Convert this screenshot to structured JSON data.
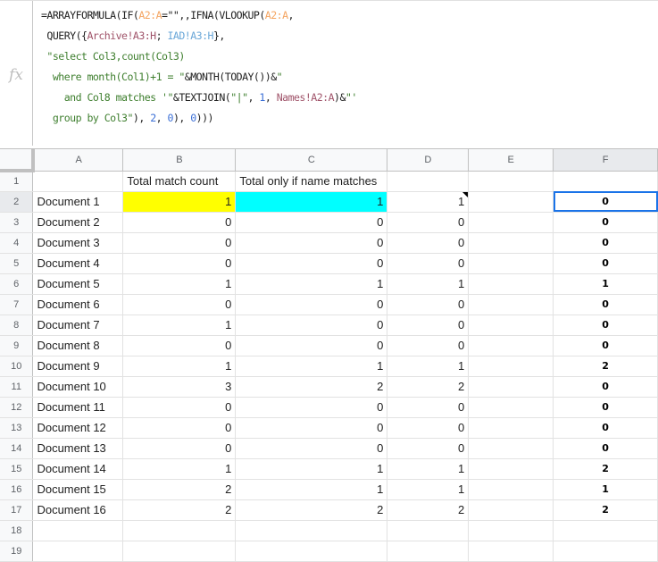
{
  "formula_bar": {
    "fx_label": "fx",
    "lines": [
      [
        {
          "t": "=ARRAYFORMULA(IF(",
          "c": ""
        },
        {
          "t": "A2:A",
          "c": "a"
        },
        {
          "t": "=\"\",,IFNA(VLOOKUP(",
          "c": ""
        },
        {
          "t": "A2:A",
          "c": "a"
        },
        {
          "t": ",",
          "c": ""
        }
      ],
      [
        {
          "t": " QUERY({",
          "c": ""
        },
        {
          "t": "Archive!A3:H",
          "c": "c"
        },
        {
          "t": "; ",
          "c": ""
        },
        {
          "t": "IAD!A3:H",
          "c": "b"
        },
        {
          "t": "},",
          "c": ""
        }
      ],
      [
        {
          "t": " \"select Col3,count(Col3)",
          "c": "s"
        }
      ],
      [
        {
          "t": "  where month(Col1)+1 = \"",
          "c": "s"
        },
        {
          "t": "&MONTH(TODAY())&",
          "c": ""
        },
        {
          "t": "\"",
          "c": "s"
        }
      ],
      [
        {
          "t": "    and Col8 matches '\"",
          "c": "s"
        },
        {
          "t": "&TEXTJOIN(",
          "c": ""
        },
        {
          "t": "\"|\"",
          "c": "s"
        },
        {
          "t": ", ",
          "c": ""
        },
        {
          "t": "1",
          "c": "n"
        },
        {
          "t": ", ",
          "c": ""
        },
        {
          "t": "Names!A2:A",
          "c": "c"
        },
        {
          "t": ")&",
          "c": ""
        },
        {
          "t": "\"'",
          "c": "s"
        }
      ],
      [
        {
          "t": "  group by Col3\"",
          "c": "s"
        },
        {
          "t": "), ",
          "c": ""
        },
        {
          "t": "2",
          "c": "n"
        },
        {
          "t": ", ",
          "c": ""
        },
        {
          "t": "0",
          "c": "n"
        },
        {
          "t": "), ",
          "c": ""
        },
        {
          "t": "0",
          "c": "n"
        },
        {
          "t": ")))",
          "c": ""
        }
      ]
    ]
  },
  "columns": [
    "A",
    "B",
    "C",
    "D",
    "E",
    "F"
  ],
  "header_row": {
    "row": "1",
    "A": "",
    "B": "Total match count",
    "C": "Total only if name matches",
    "D": "",
    "E": "",
    "F": ""
  },
  "rows": [
    {
      "row": "2",
      "A": "Document 1",
      "B": "1",
      "C": "1",
      "D": "1",
      "E": "",
      "F": "0"
    },
    {
      "row": "3",
      "A": "Document 2",
      "B": "0",
      "C": "0",
      "D": "0",
      "E": "",
      "F": "0"
    },
    {
      "row": "4",
      "A": "Document 3",
      "B": "0",
      "C": "0",
      "D": "0",
      "E": "",
      "F": "0"
    },
    {
      "row": "5",
      "A": "Document 4",
      "B": "0",
      "C": "0",
      "D": "0",
      "E": "",
      "F": "0"
    },
    {
      "row": "6",
      "A": "Document 5",
      "B": "1",
      "C": "1",
      "D": "1",
      "E": "",
      "F": "1"
    },
    {
      "row": "7",
      "A": "Document 6",
      "B": "0",
      "C": "0",
      "D": "0",
      "E": "",
      "F": "0"
    },
    {
      "row": "8",
      "A": "Document 7",
      "B": "1",
      "C": "0",
      "D": "0",
      "E": "",
      "F": "0"
    },
    {
      "row": "9",
      "A": "Document 8",
      "B": "0",
      "C": "0",
      "D": "0",
      "E": "",
      "F": "0"
    },
    {
      "row": "10",
      "A": "Document 9",
      "B": "1",
      "C": "1",
      "D": "1",
      "E": "",
      "F": "2"
    },
    {
      "row": "11",
      "A": "Document 10",
      "B": "3",
      "C": "2",
      "D": "2",
      "E": "",
      "F": "0"
    },
    {
      "row": "12",
      "A": "Document 11",
      "B": "0",
      "C": "0",
      "D": "0",
      "E": "",
      "F": "0"
    },
    {
      "row": "13",
      "A": "Document 12",
      "B": "0",
      "C": "0",
      "D": "0",
      "E": "",
      "F": "0"
    },
    {
      "row": "14",
      "A": "Document 13",
      "B": "0",
      "C": "0",
      "D": "0",
      "E": "",
      "F": "0"
    },
    {
      "row": "15",
      "A": "Document 14",
      "B": "1",
      "C": "1",
      "D": "1",
      "E": "",
      "F": "2"
    },
    {
      "row": "16",
      "A": "Document 15",
      "B": "2",
      "C": "1",
      "D": "1",
      "E": "",
      "F": "1"
    },
    {
      "row": "17",
      "A": "Document 16",
      "B": "2",
      "C": "2",
      "D": "2",
      "E": "",
      "F": "2"
    }
  ],
  "empty_rows": [
    "18",
    "19"
  ],
  "highlight": {
    "B2": "#ffff00",
    "C2": "#00ffff"
  },
  "active_cell": "F2",
  "note_cell": "D2",
  "selection_color": "#1a73e8"
}
